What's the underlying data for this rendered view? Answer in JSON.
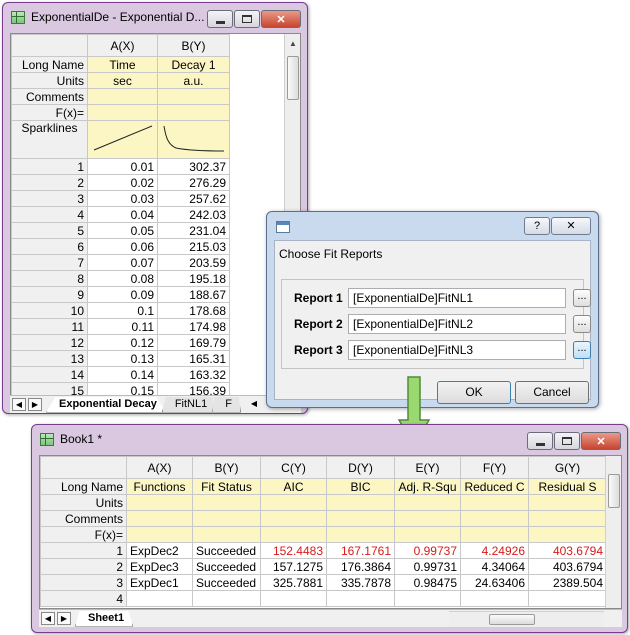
{
  "win1": {
    "title": "ExponentialDe - Exponential D...",
    "col_a": "A(X)",
    "col_b": "B(Y)",
    "rows_meta": [
      {
        "label": "Long Name",
        "a": "Time",
        "b": "Decay 1"
      },
      {
        "label": "Units",
        "a": "sec",
        "b": "a.u."
      },
      {
        "label": "Comments",
        "a": "",
        "b": ""
      },
      {
        "label": "F(x)=",
        "a": "",
        "b": ""
      }
    ],
    "sparklines_label": "Sparklines",
    "data_rows": [
      {
        "n": "1",
        "a": "0.01",
        "b": "302.37"
      },
      {
        "n": "2",
        "a": "0.02",
        "b": "276.29"
      },
      {
        "n": "3",
        "a": "0.03",
        "b": "257.62"
      },
      {
        "n": "4",
        "a": "0.04",
        "b": "242.03"
      },
      {
        "n": "5",
        "a": "0.05",
        "b": "231.04"
      },
      {
        "n": "6",
        "a": "0.06",
        "b": "215.03"
      },
      {
        "n": "7",
        "a": "0.07",
        "b": "203.59"
      },
      {
        "n": "8",
        "a": "0.08",
        "b": "195.18"
      },
      {
        "n": "9",
        "a": "0.09",
        "b": "188.67"
      },
      {
        "n": "10",
        "a": "0.1",
        "b": "178.68"
      },
      {
        "n": "11",
        "a": "0.11",
        "b": "174.98"
      },
      {
        "n": "12",
        "a": "0.12",
        "b": "169.79"
      },
      {
        "n": "13",
        "a": "0.13",
        "b": "165.31"
      },
      {
        "n": "14",
        "a": "0.14",
        "b": "163.32"
      },
      {
        "n": "15",
        "a": "0.15",
        "b": "156.39"
      }
    ],
    "tabs": [
      "Exponential Decay",
      "FitNL1",
      "F"
    ]
  },
  "dialog": {
    "help_label": "?",
    "close_label": "X",
    "group_label": "Choose Fit Reports",
    "reports": [
      {
        "label": "Report 1",
        "value": "[ExponentialDe]FitNL1",
        "btn": "..."
      },
      {
        "label": "Report 2",
        "value": "[ExponentialDe]FitNL2",
        "btn": "..."
      },
      {
        "label": "Report 3",
        "value": "[ExponentialDe]FitNL3",
        "btn": "..."
      }
    ],
    "ok_label": "OK",
    "cancel_label": "Cancel"
  },
  "win2": {
    "title": "Book1 *",
    "cols": [
      "A(X)",
      "B(Y)",
      "C(Y)",
      "D(Y)",
      "E(Y)",
      "F(Y)",
      "G(Y)"
    ],
    "meta_labels": [
      "Long Name",
      "Units",
      "Comments",
      "F(x)="
    ],
    "long_names": [
      "Functions",
      "Fit Status",
      "AIC",
      "BIC",
      "Adj. R-Squ",
      "Reduced C",
      "Residual S"
    ],
    "rows": [
      {
        "n": "1",
        "cells": [
          "ExpDec2",
          "Succeeded",
          "152.4483",
          "167.1761",
          "0.99737",
          "4.24926",
          "403.6794"
        ]
      },
      {
        "n": "2",
        "cells": [
          "ExpDec3",
          "Succeeded",
          "157.1275",
          "176.3864",
          "0.99731",
          "4.34064",
          "403.6794"
        ]
      },
      {
        "n": "3",
        "cells": [
          "ExpDec1",
          "Succeeded",
          "325.7881",
          "335.7878",
          "0.98475",
          "24.63406",
          "2389.504"
        ]
      },
      {
        "n": "4",
        "cells": [
          "",
          "",
          "",
          "",
          "",
          "",
          ""
        ]
      }
    ],
    "tabs": [
      "Sheet1"
    ]
  },
  "colors": {
    "title_frame": "#d9c8e0",
    "dialog_frame": "#c9d9ee",
    "meta_yellow": "#fbf6c4",
    "highlight_red": "#d81b1b",
    "arrow_green": "#9bd870"
  }
}
